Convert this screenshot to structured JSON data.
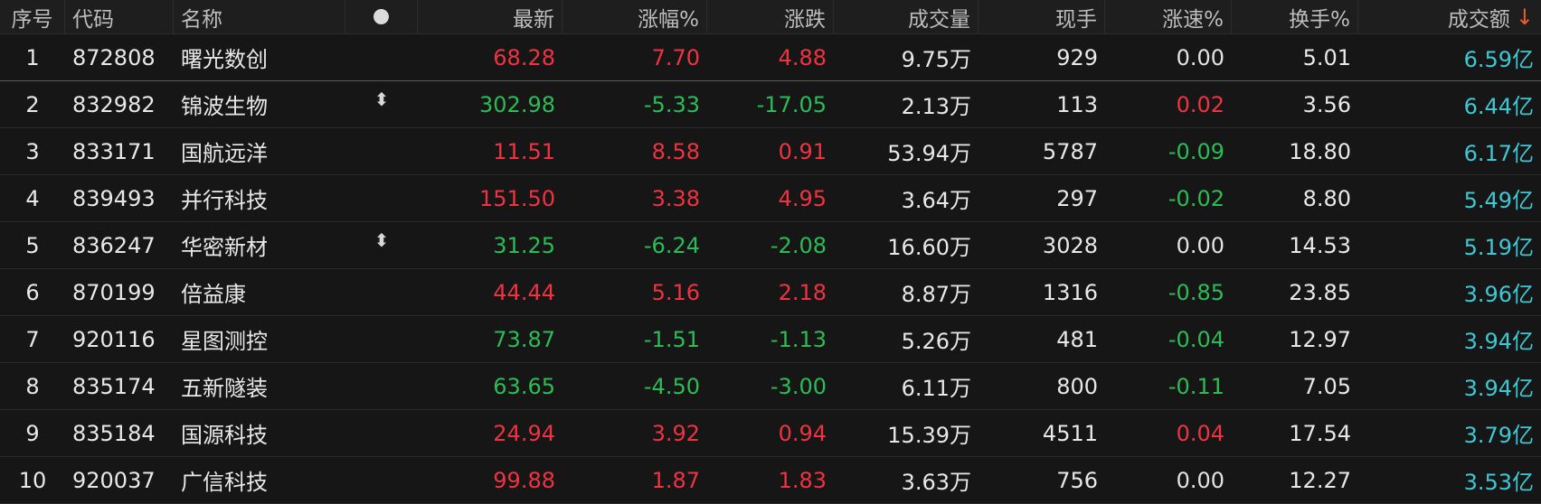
{
  "colors": {
    "up": "#ef3340",
    "down": "#2dbb55",
    "flat": "#e2e2e2",
    "amount": "#3ec8d4",
    "sort_accent": "#f05a28"
  },
  "header": {
    "cols": [
      "序号",
      "代码",
      "名称",
      "",
      "最新",
      "涨幅%",
      "涨跌",
      "成交量",
      "现手",
      "涨速%",
      "换手%",
      "成交额"
    ],
    "status_dot_icon": "filled-circle-icon",
    "sort_icon": "sort-descending-arrow-icon",
    "sort_glyph": "↓"
  },
  "rows": [
    {
      "idx": "1",
      "code": "872808",
      "name": "曙光数创",
      "mark": "",
      "last": "68.28",
      "pct": "7.70",
      "chg": "4.88",
      "vol": "9.75万",
      "hand": "929",
      "speed": "0.00",
      "turnover": "5.01",
      "amount": "6.59亿",
      "dir": "up",
      "speed_dir": "flat"
    },
    {
      "idx": "2",
      "code": "832982",
      "name": "锦波生物",
      "mark": "⬍",
      "last": "302.98",
      "pct": "-5.33",
      "chg": "-17.05",
      "vol": "2.13万",
      "hand": "113",
      "speed": "0.02",
      "turnover": "3.56",
      "amount": "6.44亿",
      "dir": "down",
      "speed_dir": "up"
    },
    {
      "idx": "3",
      "code": "833171",
      "name": "国航远洋",
      "mark": "",
      "last": "11.51",
      "pct": "8.58",
      "chg": "0.91",
      "vol": "53.94万",
      "hand": "5787",
      "speed": "-0.09",
      "turnover": "18.80",
      "amount": "6.17亿",
      "dir": "up",
      "speed_dir": "down"
    },
    {
      "idx": "4",
      "code": "839493",
      "name": "并行科技",
      "mark": "",
      "last": "151.50",
      "pct": "3.38",
      "chg": "4.95",
      "vol": "3.64万",
      "hand": "297",
      "speed": "-0.02",
      "turnover": "8.80",
      "amount": "5.49亿",
      "dir": "up",
      "speed_dir": "down"
    },
    {
      "idx": "5",
      "code": "836247",
      "name": "华密新材",
      "mark": "⬍",
      "last": "31.25",
      "pct": "-6.24",
      "chg": "-2.08",
      "vol": "16.60万",
      "hand": "3028",
      "speed": "0.00",
      "turnover": "14.53",
      "amount": "5.19亿",
      "dir": "down",
      "speed_dir": "flat"
    },
    {
      "idx": "6",
      "code": "870199",
      "name": "倍益康",
      "mark": "",
      "last": "44.44",
      "pct": "5.16",
      "chg": "2.18",
      "vol": "8.87万",
      "hand": "1316",
      "speed": "-0.85",
      "turnover": "23.85",
      "amount": "3.96亿",
      "dir": "up",
      "speed_dir": "down"
    },
    {
      "idx": "7",
      "code": "920116",
      "name": "星图测控",
      "mark": "",
      "last": "73.87",
      "pct": "-1.51",
      "chg": "-1.13",
      "vol": "5.26万",
      "hand": "481",
      "speed": "-0.04",
      "turnover": "12.97",
      "amount": "3.94亿",
      "dir": "down",
      "speed_dir": "down"
    },
    {
      "idx": "8",
      "code": "835174",
      "name": "五新隧装",
      "mark": "",
      "last": "63.65",
      "pct": "-4.50",
      "chg": "-3.00",
      "vol": "6.11万",
      "hand": "800",
      "speed": "-0.11",
      "turnover": "7.05",
      "amount": "3.94亿",
      "dir": "down",
      "speed_dir": "down"
    },
    {
      "idx": "9",
      "code": "835184",
      "name": "国源科技",
      "mark": "",
      "last": "24.94",
      "pct": "3.92",
      "chg": "0.94",
      "vol": "15.39万",
      "hand": "4511",
      "speed": "0.04",
      "turnover": "17.54",
      "amount": "3.79亿",
      "dir": "up",
      "speed_dir": "up"
    },
    {
      "idx": "10",
      "code": "920037",
      "name": "广信科技",
      "mark": "",
      "last": "99.88",
      "pct": "1.87",
      "chg": "1.83",
      "vol": "3.63万",
      "hand": "756",
      "speed": "0.00",
      "turnover": "12.27",
      "amount": "3.53亿",
      "dir": "up",
      "speed_dir": "flat"
    }
  ]
}
